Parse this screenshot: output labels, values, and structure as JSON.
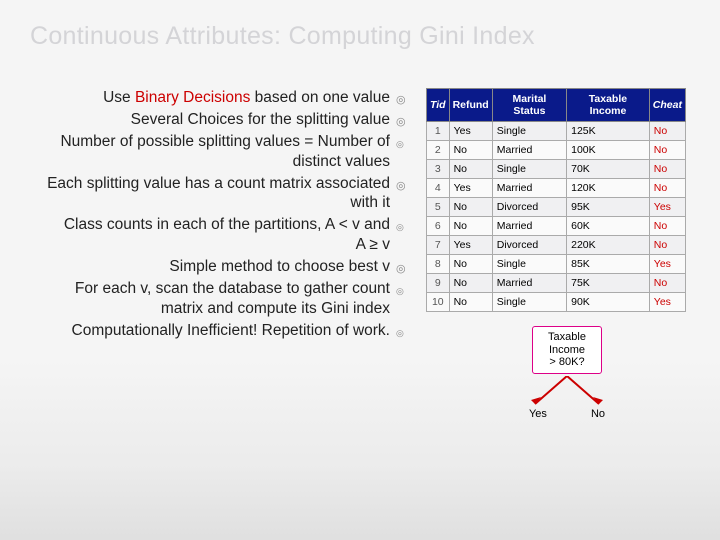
{
  "title": "Continuous Attributes: Computing Gini Index",
  "bullets": [
    {
      "level": 0,
      "html": "Use <span class='red'>Binary Decisions</span> based on one value"
    },
    {
      "level": 0,
      "html": "Several Choices for the splitting value"
    },
    {
      "level": 1,
      "html": "Number of possible splitting values = Number of distinct values"
    },
    {
      "level": 0,
      "html": "Each splitting value has a count matrix associated with it"
    },
    {
      "level": 1,
      "html": "Class counts in each of the partitions, A &lt; v and A &ge; v"
    },
    {
      "level": 0,
      "html": "Simple method to choose best v"
    },
    {
      "level": 1,
      "html": "For each v, scan the database to gather count matrix and compute its Gini index"
    },
    {
      "level": 1,
      "html": "Computationally Inefficient! Repetition of work."
    }
  ],
  "bullet_glyphs": {
    "main": "◎",
    "sub": "◎"
  },
  "table": {
    "headers": [
      "Tid",
      "Refund",
      "Marital Status",
      "Taxable Income",
      "Cheat"
    ],
    "rows": [
      [
        "1",
        "Yes",
        "Single",
        "125K",
        "No"
      ],
      [
        "2",
        "No",
        "Married",
        "100K",
        "No"
      ],
      [
        "3",
        "No",
        "Single",
        "70K",
        "No"
      ],
      [
        "4",
        "Yes",
        "Married",
        "120K",
        "No"
      ],
      [
        "5",
        "No",
        "Divorced",
        "95K",
        "Yes"
      ],
      [
        "6",
        "No",
        "Married",
        "60K",
        "No"
      ],
      [
        "7",
        "Yes",
        "Divorced",
        "220K",
        "No"
      ],
      [
        "8",
        "No",
        "Single",
        "85K",
        "Yes"
      ],
      [
        "9",
        "No",
        "Married",
        "75K",
        "No"
      ],
      [
        "10",
        "No",
        "Single",
        "90K",
        "Yes"
      ]
    ]
  },
  "decision": {
    "label_line1": "Taxable",
    "label_line2": "Income",
    "label_line3": "> 80K?",
    "yes": "Yes",
    "no": "No"
  }
}
